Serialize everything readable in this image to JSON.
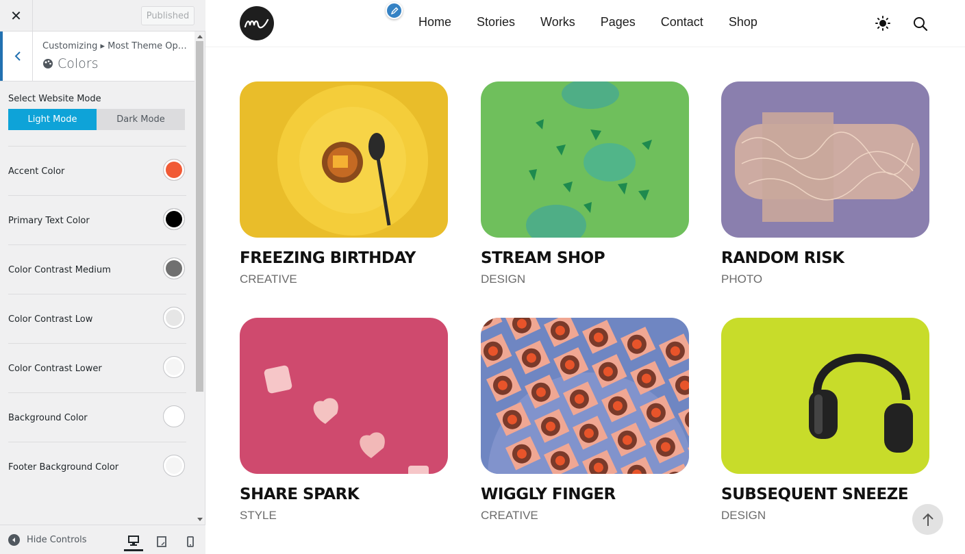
{
  "panel": {
    "close_icon": "close-icon",
    "published_label": "Published",
    "breadcrumb": "Customizing ▸ Most Theme Optio...",
    "section_name": "Colors",
    "mode": {
      "label": "Select Website Mode",
      "options": [
        "Light Mode",
        "Dark Mode"
      ],
      "selected": "Light Mode"
    },
    "colors": [
      {
        "label": "Accent Color",
        "value": "#f15a35"
      },
      {
        "label": "Primary Text Color",
        "value": "#000000"
      },
      {
        "label": "Color Contrast Medium",
        "value": "#707070"
      },
      {
        "label": "Color Contrast Low",
        "value": "#e6e6e6"
      },
      {
        "label": "Color Contrast Lower",
        "value": "#f5f5f5"
      },
      {
        "label": "Background Color",
        "value": "#ffffff"
      },
      {
        "label": "Footer Background Color",
        "value": "#f5f5f5"
      }
    ],
    "footer": {
      "hide_controls": "Hide Controls",
      "devices": [
        "desktop-icon",
        "tablet-icon",
        "mobile-icon"
      ],
      "active_device": "desktop"
    }
  },
  "site": {
    "nav": [
      "Home",
      "Stories",
      "Works",
      "Pages",
      "Contact",
      "Shop"
    ],
    "posts": [
      {
        "title": "FREEZING BIRTHDAY",
        "category": "CREATIVE",
        "color": "#e9bd2a"
      },
      {
        "title": "STREAM SHOP",
        "category": "DESIGN",
        "color": "#6fbf5c"
      },
      {
        "title": "RANDOM RISK",
        "category": "PHOTO",
        "color": "#8a7fae"
      },
      {
        "title": "SHARE SPARK",
        "category": "STYLE",
        "color": "#cf4a6e"
      },
      {
        "title": "WIGGLY FINGER",
        "category": "CREATIVE",
        "color": "#6f86c2"
      },
      {
        "title": "SUBSEQUENT SNEEZE",
        "category": "DESIGN",
        "color": "#c8dc2a"
      }
    ]
  }
}
